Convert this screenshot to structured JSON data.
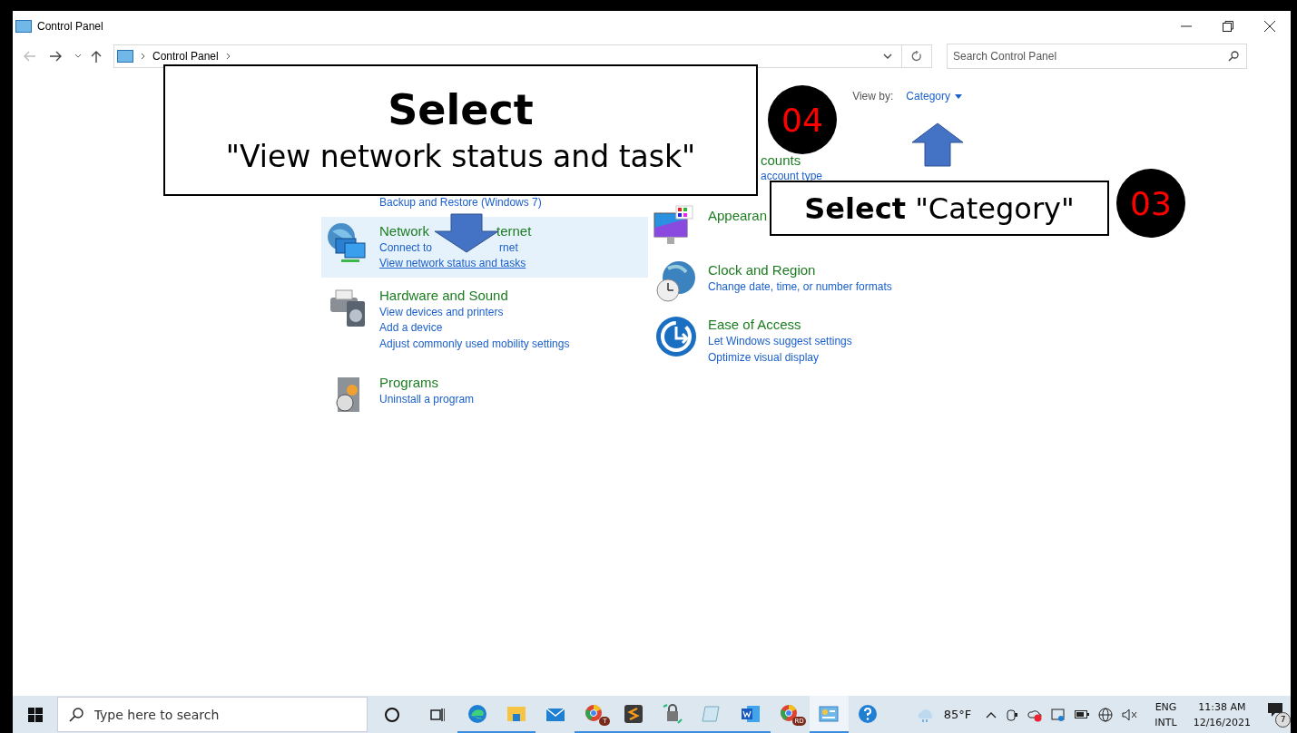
{
  "window": {
    "title": "Control Panel"
  },
  "address_bar": {
    "crumbs": [
      "Control Panel"
    ]
  },
  "search": {
    "placeholder": "Search Control Panel"
  },
  "view_by": {
    "label": "View by:",
    "value": "Category"
  },
  "columns": [
    {
      "items": [
        {
          "kind": "fragment",
          "selected": false,
          "links": [
            {
              "parts": [
                "Backup and Restore (Windows 7)"
              ],
              "hovered": false
            }
          ]
        },
        {
          "kind": "category",
          "selected": true,
          "title_parts": [
            "Network",
            "ternet"
          ],
          "links": [
            {
              "parts": [
                "Connect to",
                "rnet"
              ],
              "hovered": false
            },
            {
              "parts": [
                "View network status and tasks"
              ],
              "hovered": true
            }
          ]
        },
        {
          "kind": "category",
          "selected": false,
          "title_parts": [
            "Hardware and Sound"
          ],
          "links": [
            {
              "parts": [
                "View devices and printers"
              ],
              "hovered": false
            },
            {
              "parts": [
                "Add a device"
              ],
              "hovered": false
            },
            {
              "parts": [
                "Adjust commonly used mobility settings"
              ],
              "hovered": false
            }
          ]
        },
        {
          "kind": "category",
          "selected": false,
          "title_parts": [
            "Programs"
          ],
          "links": [
            {
              "parts": [
                "Uninstall a program"
              ],
              "hovered": false
            }
          ]
        }
      ]
    },
    {
      "items": [
        {
          "kind": "covered",
          "selected": false,
          "title_parts": [
            "counts"
          ],
          "links": [
            {
              "parts": [
                "account type"
              ],
              "hovered": false
            }
          ]
        },
        {
          "kind": "category",
          "selected": false,
          "title_parts": [
            "Appearan"
          ]
        },
        {
          "kind": "category",
          "selected": false,
          "title_parts": [
            "Clock and Region"
          ],
          "links": [
            {
              "parts": [
                "Change date, time, or number formats"
              ],
              "hovered": false
            }
          ]
        },
        {
          "kind": "category",
          "selected": false,
          "title_parts": [
            "Ease of Access"
          ],
          "links": [
            {
              "parts": [
                "Let Windows suggest settings"
              ],
              "hovered": false
            },
            {
              "parts": [
                "Optimize visual display"
              ],
              "hovered": false
            }
          ]
        }
      ]
    }
  ],
  "annotations": [
    {
      "kind": "callout",
      "title": "Select",
      "text": "\"View network status and task\""
    },
    {
      "kind": "badge",
      "text": "04"
    },
    {
      "kind": "callout",
      "text": "**Select** \"Category\""
    },
    {
      "kind": "badge",
      "text": "03"
    }
  ],
  "taskbar": {
    "search_placeholder": "Type here to search",
    "apps": [
      {
        "running": true,
        "selected": false
      },
      {
        "running": true,
        "selected": false
      },
      {
        "running": false,
        "selected": false
      },
      {
        "running": true,
        "selected": false,
        "badge": "T"
      },
      {
        "running": true,
        "selected": false
      },
      {
        "running": true,
        "selected": false
      },
      {
        "running": true,
        "selected": false
      },
      {
        "running": true,
        "selected": false
      },
      {
        "running": false,
        "selected": false,
        "badge": "RD"
      },
      {
        "running": true,
        "selected": true
      },
      {
        "running": false,
        "selected": false
      }
    ],
    "weather": "85°F",
    "language": [
      "ENG",
      "INTL"
    ],
    "time": "11:38 AM",
    "date": "12/16/2021",
    "notifications": "7"
  }
}
